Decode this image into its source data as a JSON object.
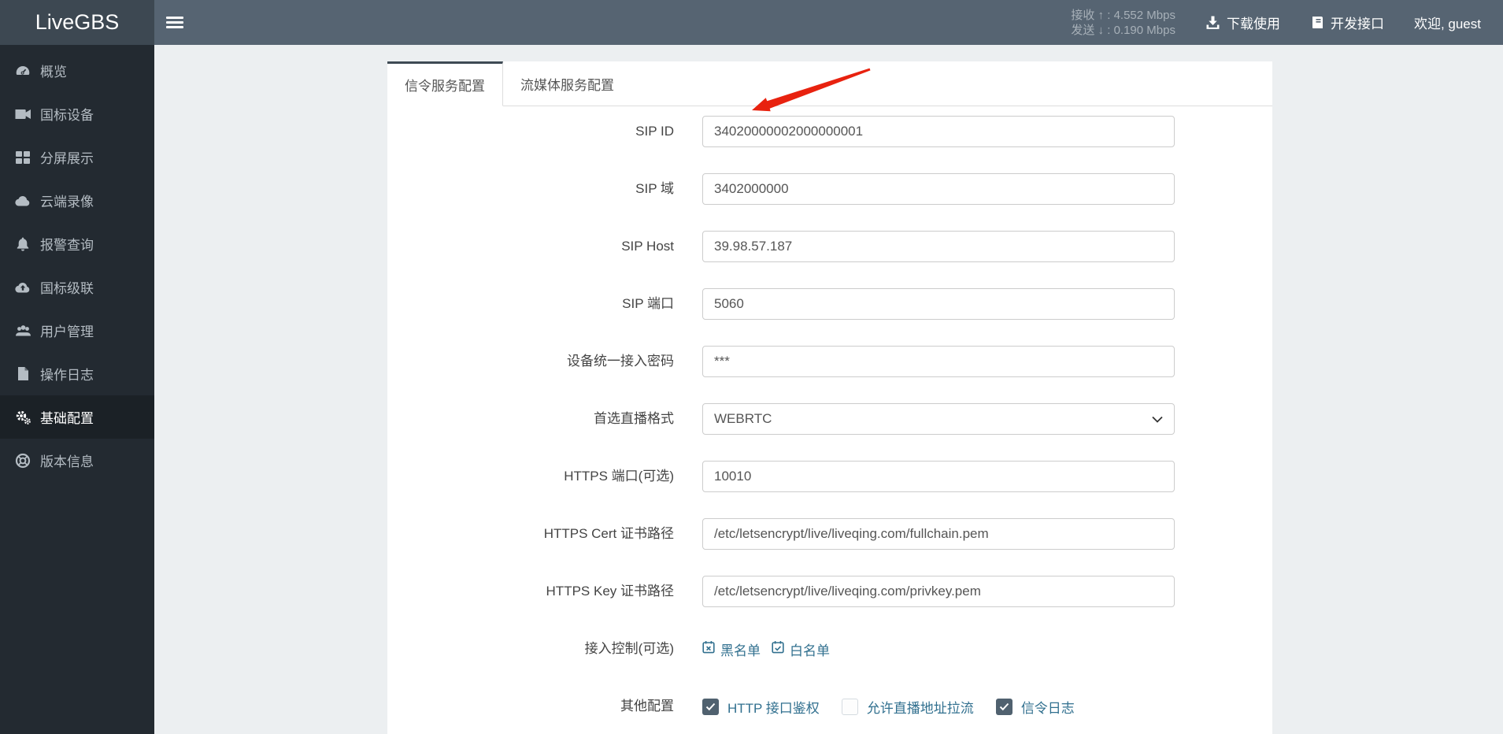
{
  "brand": {
    "name": "LiveGBS"
  },
  "header": {
    "stats": [
      {
        "label": "接收",
        "arrow": "↑",
        "sep": ":",
        "value": "4.552 Mbps"
      },
      {
        "label": "发送",
        "arrow": "↓",
        "sep": ":",
        "value": "0.190 Mbps"
      }
    ],
    "download_label": "下载使用",
    "api_label": "开发接口",
    "welcome": "欢迎, guest"
  },
  "sidebar": {
    "items": [
      {
        "label": "概览",
        "icon": "gauge-icon",
        "active": false
      },
      {
        "label": "国标设备",
        "icon": "video-camera-icon",
        "active": false
      },
      {
        "label": "分屏展示",
        "icon": "grid-icon",
        "active": false
      },
      {
        "label": "云端录像",
        "icon": "cloud-icon",
        "active": false
      },
      {
        "label": "报警查询",
        "icon": "bell-icon",
        "active": false
      },
      {
        "label": "国标级联",
        "icon": "cloud-upload-icon",
        "active": false
      },
      {
        "label": "用户管理",
        "icon": "users-icon",
        "active": false
      },
      {
        "label": "操作日志",
        "icon": "file-icon",
        "active": false
      },
      {
        "label": "基础配置",
        "icon": "gears-icon",
        "active": true
      },
      {
        "label": "版本信息",
        "icon": "life-ring-icon",
        "active": false
      }
    ]
  },
  "tabs": [
    {
      "label": "信令服务配置",
      "active": true
    },
    {
      "label": "流媒体服务配置",
      "active": false
    }
  ],
  "form": {
    "rows": [
      {
        "label": "SIP ID",
        "type": "input",
        "value": "34020000002000000001"
      },
      {
        "label": "SIP 域",
        "type": "input",
        "value": "3402000000"
      },
      {
        "label": "SIP Host",
        "type": "input",
        "value": "39.98.57.187"
      },
      {
        "label": "SIP 端口",
        "type": "input",
        "value": "5060"
      },
      {
        "label": "设备统一接入密码",
        "type": "input",
        "value": "***"
      },
      {
        "label": "首选直播格式",
        "type": "select",
        "value": "WEBRTC"
      },
      {
        "label": "HTTPS 端口(可选)",
        "type": "input",
        "value": "10010"
      },
      {
        "label": "HTTPS Cert 证书路径",
        "type": "input",
        "value": "/etc/letsencrypt/live/liveqing.com/fullchain.pem"
      },
      {
        "label": "HTTPS Key 证书路径",
        "type": "input",
        "value": "/etc/letsencrypt/live/liveqing.com/privkey.pem"
      },
      {
        "label": "接入控制(可选)",
        "type": "links",
        "links": [
          {
            "label": "黑名单",
            "icon": "calendar-x-icon"
          },
          {
            "label": "白名单",
            "icon": "calendar-check-icon"
          }
        ]
      },
      {
        "label": "其他配置",
        "type": "checkboxes",
        "options": [
          {
            "label": "HTTP 接口鉴权",
            "checked": true
          },
          {
            "label": "允许直播地址拉流",
            "checked": false
          },
          {
            "label": "信令日志",
            "checked": true
          }
        ]
      }
    ]
  },
  "annotation": {
    "type": "red-arrow",
    "points_at": "信令服务配置 tab / SIP ID field",
    "color": "#e8220f"
  },
  "colors": {
    "navbar": "#566472",
    "logo_bg": "#3d4852",
    "sidebar_bg": "#232a31",
    "sidebar_active_bg": "#1b2126",
    "link_blue": "#31708f",
    "checkbox_fill": "#50616f",
    "tab_top_border": "#3e4a54",
    "page_bg": "#eceff1"
  }
}
